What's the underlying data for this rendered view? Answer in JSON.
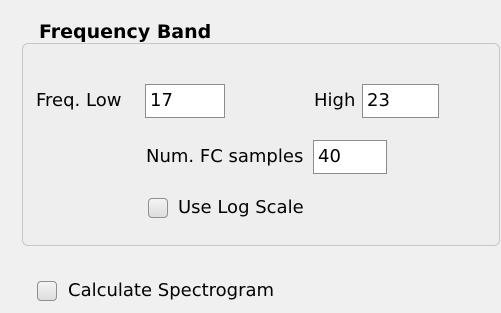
{
  "group": {
    "title": "Frequency Band"
  },
  "freq_low": {
    "label": "Freq. Low",
    "value": "17"
  },
  "high": {
    "label": "High",
    "value": "23"
  },
  "num_fc": {
    "label": "Num. FC samples",
    "value": "40"
  },
  "log_scale": {
    "label": "Use Log Scale",
    "checked": false
  },
  "spectrogram": {
    "label": "Calculate Spectrogram",
    "checked": false
  }
}
